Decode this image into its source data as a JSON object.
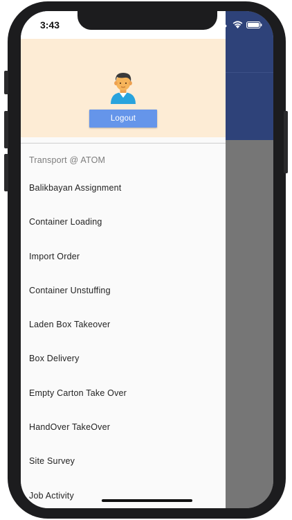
{
  "status_bar": {
    "time": "3:43",
    "icons": [
      "signal-dots-icon",
      "wifi-icon",
      "battery-icon"
    ]
  },
  "drawer": {
    "avatar_icon": "user-avatar-icon",
    "logout_label": "Logout",
    "section_header": "Transport @ ATOM",
    "items": [
      {
        "label": "Balikbayan Assignment"
      },
      {
        "label": "Container Loading"
      },
      {
        "label": "Import Order"
      },
      {
        "label": "Container Unstuffing"
      },
      {
        "label": "Laden Box Takeover"
      },
      {
        "label": "Box Delivery"
      },
      {
        "label": "Empty Carton Take Over"
      },
      {
        "label": "HandOver TakeOver"
      },
      {
        "label": "Site Survey"
      },
      {
        "label": "Job Activity"
      }
    ]
  },
  "colors": {
    "app_bar": "#2e4279",
    "drawer_header": "#fdecd5",
    "logout_button": "#6595ea",
    "scrim": "#767676",
    "phone_frame": "#1c1c1e"
  }
}
